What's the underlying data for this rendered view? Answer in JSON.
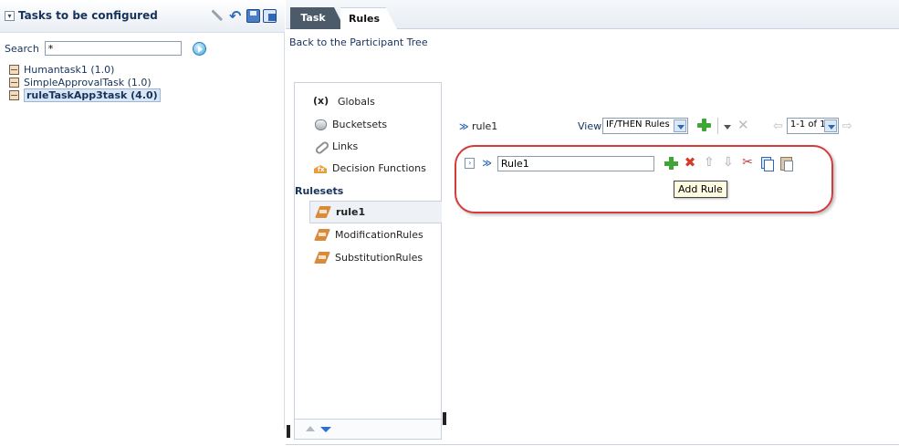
{
  "left_panel": {
    "title": "Tasks to be configured",
    "search": {
      "label": "Search",
      "value": "*"
    },
    "tasks": [
      {
        "label": "Humantask1 (1.0)",
        "selected": false
      },
      {
        "label": "SimpleApprovalTask (1.0)",
        "selected": false
      },
      {
        "label": "ruleTaskApp3task (4.0)",
        "selected": true
      }
    ]
  },
  "tabs": [
    {
      "label": "Task",
      "active": false
    },
    {
      "label": "Rules",
      "active": true
    }
  ],
  "back_link": "Back to the Participant Tree",
  "navigator": {
    "items": [
      {
        "icon_text": "(x)",
        "label": "Globals"
      },
      {
        "label": "Bucketsets"
      },
      {
        "label": "Links"
      },
      {
        "label": "Decision Functions"
      }
    ],
    "rulesets_heading": "Rulesets",
    "rulesets": [
      {
        "label": "rule1",
        "active": true
      },
      {
        "label": "ModificationRules",
        "active": false
      },
      {
        "label": "SubstitutionRules",
        "active": false
      }
    ]
  },
  "ruleset_editor": {
    "ruleset_name": "rule1",
    "view_label": "View",
    "view_value": "IF/THEN Rules",
    "pager_value": "1-1 of 1",
    "rule": {
      "name": "Rule1"
    },
    "tooltip": "Add Rule"
  },
  "colors": {
    "highlight": "#d43b3b",
    "accent_blue": "#2f68b6",
    "add_green": "#3fa537",
    "delete_red": "#d43b2b"
  }
}
